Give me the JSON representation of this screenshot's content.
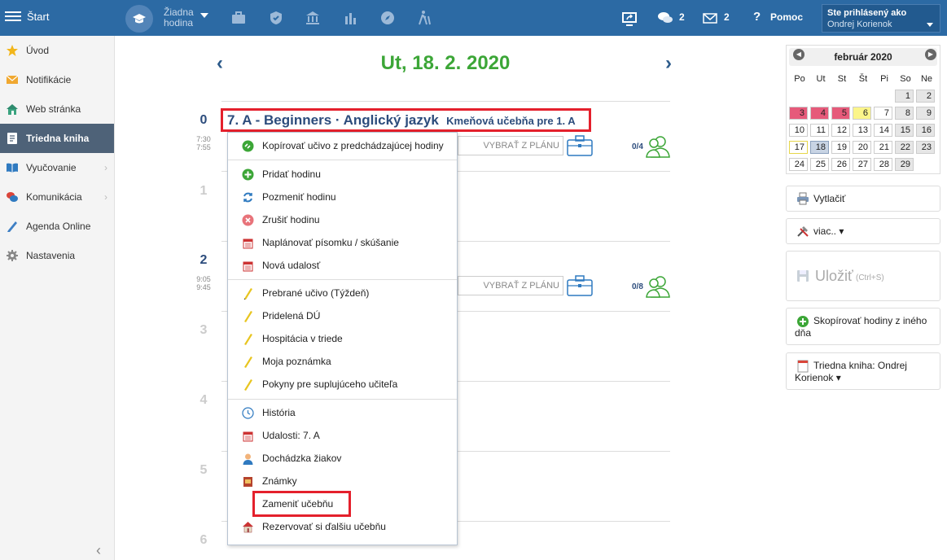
{
  "topbar": {
    "start_label": "Štart",
    "lesson_label": "Žiadna hodina",
    "messages_count": "2",
    "mail_count": "2",
    "help_label": "Pomoc",
    "user_line1": "Ste prihlásený ako",
    "user_line2": "Ondrej Korienok"
  },
  "sidebar": {
    "items": [
      {
        "label": "Úvod",
        "icon": "star-icon"
      },
      {
        "label": "Notifikácie",
        "icon": "envelope-icon"
      },
      {
        "label": "Web stránka",
        "icon": "house-icon"
      },
      {
        "label": "Triedna kniha",
        "icon": "book-icon"
      },
      {
        "label": "Vyučovanie",
        "icon": "open-book-icon"
      },
      {
        "label": "Komunikácia",
        "icon": "chat-icon"
      },
      {
        "label": "Agenda Online",
        "icon": "pen-icon"
      },
      {
        "label": "Nastavenia",
        "icon": "gear-icon"
      }
    ],
    "active_index": 3
  },
  "day": {
    "prev": "‹",
    "next": "›",
    "date": "Ut, 18. 2. 2020"
  },
  "lessons": {
    "numbers": [
      "0",
      "1",
      "2",
      "3",
      "4",
      "5",
      "6"
    ],
    "l0": {
      "title": "7. A - Beginners · Anglický jazyk",
      "room": "Kmeňová učebňa pre 1. A",
      "time_start": "7:30",
      "time_end": "7:55",
      "plan_placeholder": "VYBRAŤ Z PLÁNU",
      "count": "0/4"
    },
    "l2": {
      "time_start": "9:05",
      "time_end": "9:45",
      "plan_placeholder": "VYBRAŤ Z PLÁNU",
      "count": "0/8"
    }
  },
  "context_menu": {
    "items": [
      {
        "label": "Kopírovať učivo z predchádzajúcej hodiny",
        "icon": "copy-green-icon"
      },
      {
        "label": "Pridať hodinu",
        "icon": "plus-green-icon"
      },
      {
        "label": "Pozmeniť hodinu",
        "icon": "refresh-icon"
      },
      {
        "label": "Zrušiť hodinu",
        "icon": "cancel-red-icon"
      },
      {
        "label": "Naplánovať písomku / skúšanie",
        "icon": "calendar-red-icon"
      },
      {
        "label": "Nová udalosť",
        "icon": "calendar-red-icon"
      },
      {
        "label": "Prebrané učivo (Týždeň)",
        "icon": "pencil-icon"
      },
      {
        "label": "Pridelená DÚ",
        "icon": "pencil-icon"
      },
      {
        "label": "Hospitácia v triede",
        "icon": "pencil-icon"
      },
      {
        "label": "Moja poznámka",
        "icon": "pencil-icon"
      },
      {
        "label": "Pokyny pre suplujúceho učiteľa",
        "icon": "pencil-icon"
      },
      {
        "label": "História",
        "icon": "clock-icon"
      },
      {
        "label": "Udalosti: 7. A",
        "icon": "calendar-red-icon"
      },
      {
        "label": "Dochádzka žiakov",
        "icon": "person-icon"
      },
      {
        "label": "Známky",
        "icon": "grades-book-icon"
      },
      {
        "label": "Zameniť učebňu",
        "icon": ""
      },
      {
        "label": "Rezervovať si ďalšiu učebňu",
        "icon": "house-red-icon"
      }
    ]
  },
  "calendar": {
    "month": "február 2020",
    "weekdays": [
      "Po",
      "Ut",
      "St",
      "Št",
      "Pi",
      "So",
      "Ne"
    ],
    "weeks": [
      [
        "",
        "",
        "",
        "",
        "",
        "1",
        "2"
      ],
      [
        "3",
        "4",
        "5",
        "6",
        "7",
        "8",
        "9"
      ],
      [
        "10",
        "11",
        "12",
        "13",
        "14",
        "15",
        "16"
      ],
      [
        "17",
        "18",
        "19",
        "20",
        "21",
        "22",
        "23"
      ],
      [
        "24",
        "25",
        "26",
        "27",
        "28",
        "29",
        ""
      ]
    ],
    "highlights": {
      "red": [
        "3",
        "4",
        "5"
      ],
      "yellow": [
        "6"
      ],
      "today": "18",
      "outlined_yellow": [
        "17"
      ]
    }
  },
  "right_panel": {
    "print_label": "Vytlačiť",
    "more_label": "viac.. ▾",
    "save_label": "Uložiť",
    "save_shortcut": "(Ctrl+S)",
    "copy_lessons_label": "Skopírovať hodiny z iného dňa",
    "class_book_label": "Triedna kniha: Ondrej Korienok ▾"
  }
}
